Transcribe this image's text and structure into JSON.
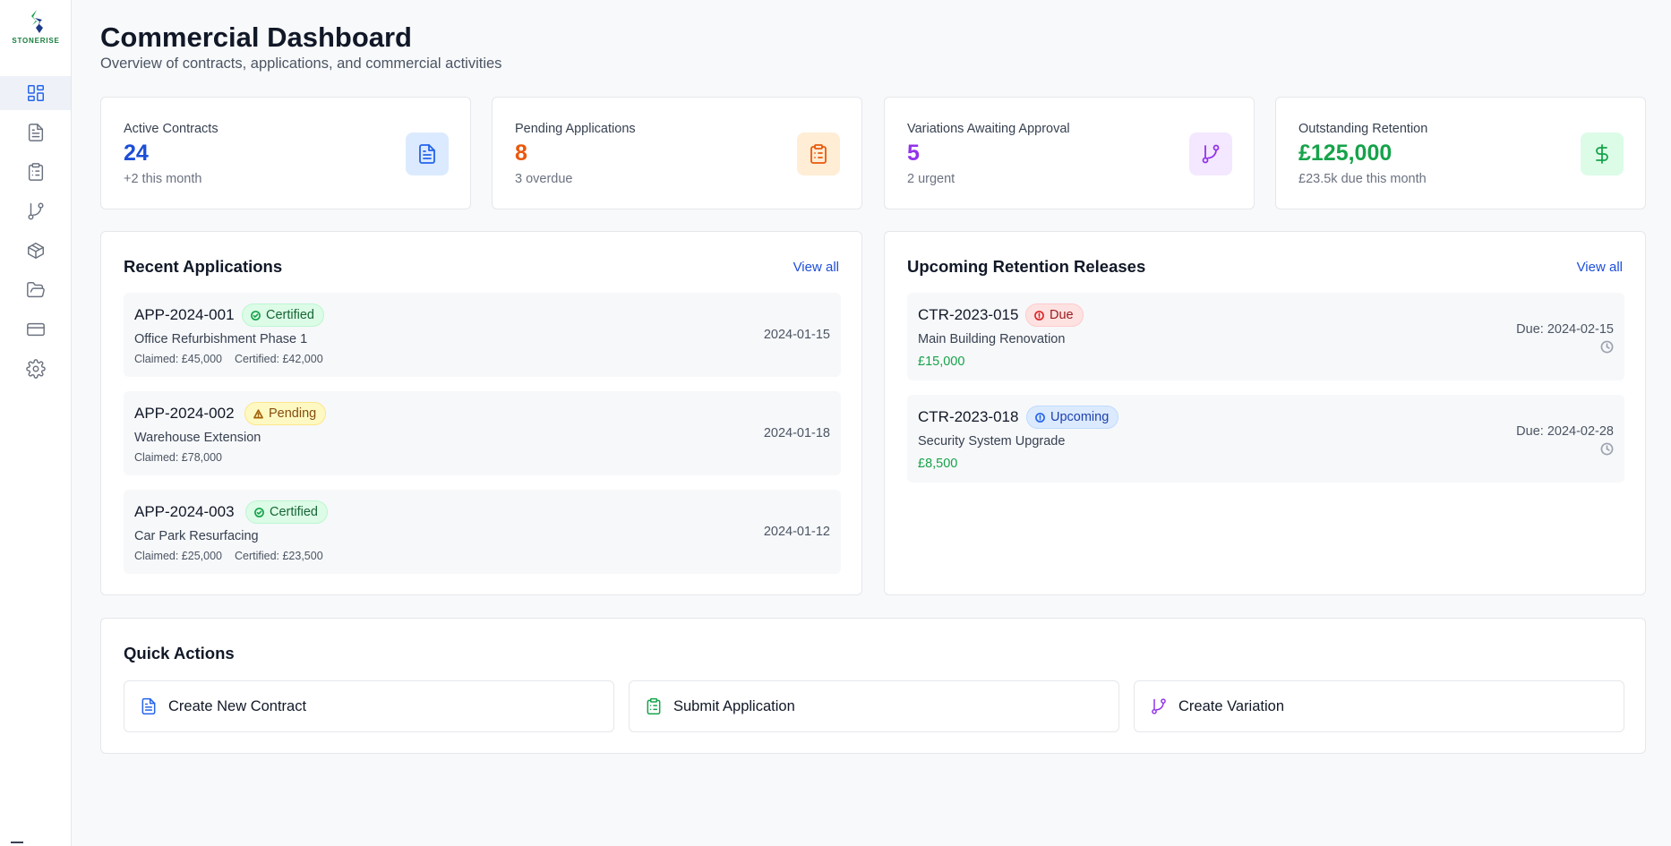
{
  "brand": {
    "logo_text": "STONERISE"
  },
  "sidebar": {
    "items": [
      {
        "icon": "dashboard-icon",
        "active": true
      },
      {
        "icon": "document-icon",
        "active": false
      },
      {
        "icon": "clipboard-list-icon",
        "active": false
      },
      {
        "icon": "git-branch-icon",
        "active": false
      },
      {
        "icon": "package-icon",
        "active": false
      },
      {
        "icon": "folder-open-icon",
        "active": false
      },
      {
        "icon": "credit-card-icon",
        "active": false
      },
      {
        "icon": "gear-icon",
        "active": false
      }
    ]
  },
  "header": {
    "title": "Commercial Dashboard",
    "subtitle": "Overview of contracts, applications, and commercial activities"
  },
  "stats": [
    {
      "label": "Active Contracts",
      "value": "24",
      "sub": "+2 this month",
      "icon": "document-icon",
      "color": "#1d4ed8",
      "icon_bg": "#dbeafe"
    },
    {
      "label": "Pending Applications",
      "value": "8",
      "sub": "3 overdue",
      "icon": "clipboard-list-icon",
      "color": "#ea580c",
      "icon_bg": "#ffedd5"
    },
    {
      "label": "Variations Awaiting Approval",
      "value": "5",
      "sub": "2 urgent",
      "icon": "git-branch-icon",
      "color": "#9333ea",
      "icon_bg": "#f3e8ff"
    },
    {
      "label": "Outstanding Retention",
      "value": "£125,000",
      "sub": "£23.5k due this month",
      "icon": "dollar-icon",
      "color": "#16a34a",
      "icon_bg": "#dcfce7"
    }
  ],
  "recent_applications": {
    "title": "Recent Applications",
    "view_all": "View all",
    "rows": [
      {
        "id": "APP-2024-001",
        "status": "Certified",
        "name": "Office Refurbishment Phase 1",
        "claimed": "Claimed: £45,000",
        "certified": "Certified: £42,000",
        "date": "2024-01-15"
      },
      {
        "id": "APP-2024-002",
        "status": "Pending",
        "name": "Warehouse Extension",
        "claimed": "Claimed: £78,000",
        "certified": "",
        "date": "2024-01-18"
      },
      {
        "id": "APP-2024-003",
        "status": "Certified",
        "name": "Car Park Resurfacing",
        "claimed": "Claimed: £25,000",
        "certified": "Certified: £23,500",
        "date": "2024-01-12"
      }
    ]
  },
  "retention_releases": {
    "title": "Upcoming Retention Releases",
    "view_all": "View all",
    "rows": [
      {
        "id": "CTR-2023-015",
        "status": "Due",
        "name": "Main Building Renovation",
        "amount": "£15,000",
        "due": "Due: 2024-02-15"
      },
      {
        "id": "CTR-2023-018",
        "status": "Upcoming",
        "name": "Security System Upgrade",
        "amount": "£8,500",
        "due": "Due: 2024-02-28"
      }
    ]
  },
  "quick_actions": {
    "title": "Quick Actions",
    "buttons": [
      {
        "label": "Create New Contract",
        "icon": "document-icon",
        "color": "#2563eb"
      },
      {
        "label": "Submit Application",
        "icon": "clipboard-list-icon",
        "color": "#16a34a"
      },
      {
        "label": "Create Variation",
        "icon": "git-branch-icon",
        "color": "#9333ea"
      }
    ]
  }
}
